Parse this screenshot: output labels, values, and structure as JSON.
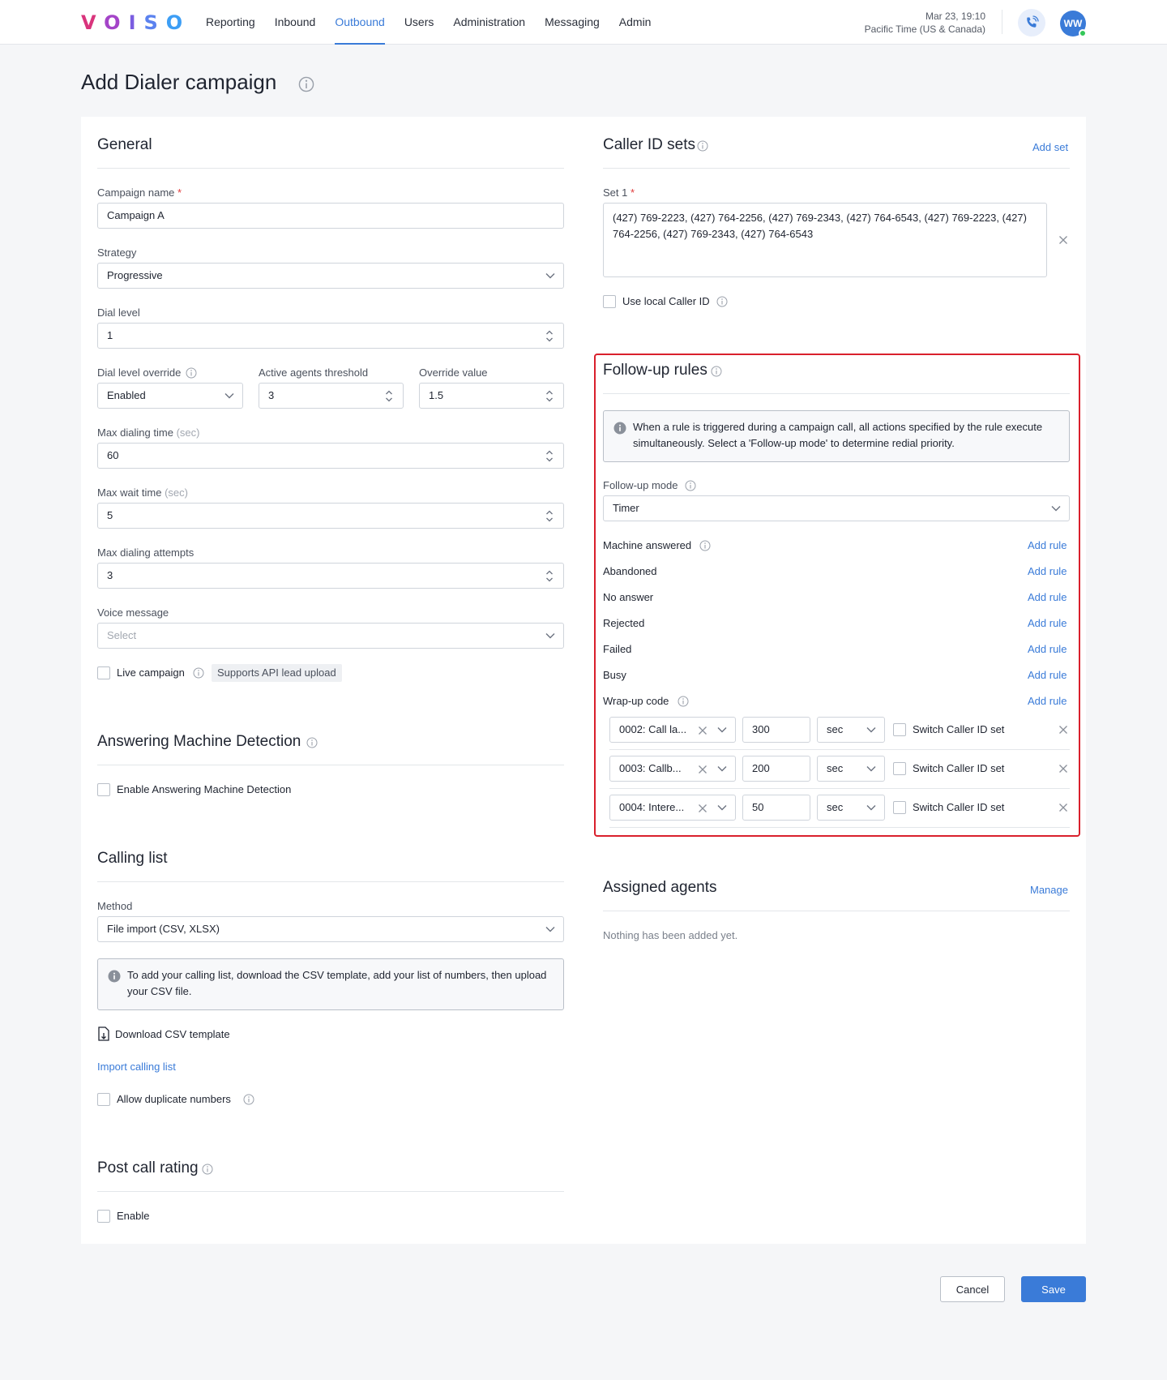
{
  "header": {
    "logo": [
      "V",
      "O",
      "I",
      "S",
      "O"
    ],
    "nav": [
      "Reporting",
      "Inbound",
      "Outbound",
      "Users",
      "Administration",
      "Messaging",
      "Admin"
    ],
    "active_nav": "Outbound",
    "clock_date": "Mar 23, 19:10",
    "clock_tz": "Pacific Time (US & Canada)",
    "avatar_initials": "WW"
  },
  "page": {
    "title": "Add Dialer campaign"
  },
  "general": {
    "title": "General",
    "campaign_name_label": "Campaign name",
    "required_mark": "*",
    "campaign_name_value": "Campaign A",
    "strategy_label": "Strategy",
    "strategy_value": "Progressive",
    "dial_level_label": "Dial level",
    "dial_level_value": "1",
    "dial_override_label": "Dial level override",
    "dial_override_value": "Enabled",
    "active_threshold_label": "Active agents threshold",
    "active_threshold_value": "3",
    "override_value_label": "Override value",
    "override_value_value": "1.5",
    "max_dialing_time_label": "Max dialing time",
    "unit_sec": "(sec)",
    "max_dialing_time_value": "60",
    "max_wait_time_label": "Max wait time",
    "max_wait_time_value": "5",
    "max_attempts_label": "Max dialing attempts",
    "max_attempts_value": "3",
    "voice_message_label": "Voice message",
    "voice_message_placeholder": "Select",
    "live_campaign_label": "Live campaign",
    "api_tag": "Supports API lead upload"
  },
  "amd": {
    "title": "Answering Machine Detection",
    "enable_label": "Enable Answering Machine Detection"
  },
  "calling_list": {
    "title": "Calling list",
    "method_label": "Method",
    "method_value": "File import (CSV, XLSX)",
    "notice": "To add your calling list, download the CSV template, add your list of numbers, then upload your CSV file.",
    "download_label": "Download CSV template",
    "import_link": "Import calling list",
    "allow_duplicates_label": "Allow duplicate numbers"
  },
  "post_call": {
    "title": "Post call rating",
    "enable_label": "Enable"
  },
  "caller_id": {
    "title": "Caller ID sets",
    "add_set": "Add set",
    "set_label": "Set 1",
    "set_value": "(427) 769-2223, (427) 764-2256, (427) 769-2343, (427) 764-6543, (427) 769-2223, (427) 764-2256, (427) 769-2343, (427) 764-6543",
    "use_local_label": "Use local Caller ID"
  },
  "followup": {
    "title": "Follow-up rules",
    "notice": "When a rule is triggered during a campaign call, all actions specified by the rule execute simultaneously. Select a 'Follow-up mode' to determine redial priority.",
    "mode_label": "Follow-up mode",
    "mode_value": "Timer",
    "add_rule": "Add rule",
    "rules": [
      "Machine answered",
      "Abandoned",
      "No answer",
      "Rejected",
      "Failed",
      "Busy",
      "Wrap-up code"
    ],
    "wrapup_rows": [
      {
        "code": "0002: Call la...",
        "time": "300",
        "unit": "sec",
        "switch_label": "Switch Caller ID set"
      },
      {
        "code": "0003: Callb...",
        "time": "200",
        "unit": "sec",
        "switch_label": "Switch Caller ID set"
      },
      {
        "code": "0004: Intere...",
        "time": "50",
        "unit": "sec",
        "switch_label": "Switch Caller ID set"
      }
    ]
  },
  "agents": {
    "title": "Assigned agents",
    "manage": "Manage",
    "empty": "Nothing has been added yet."
  },
  "footer": {
    "cancel": "Cancel",
    "save": "Save"
  },
  "colors": {
    "accent": "#3a7bd8",
    "highlight": "#d9202c",
    "required": "#e03a3a"
  }
}
